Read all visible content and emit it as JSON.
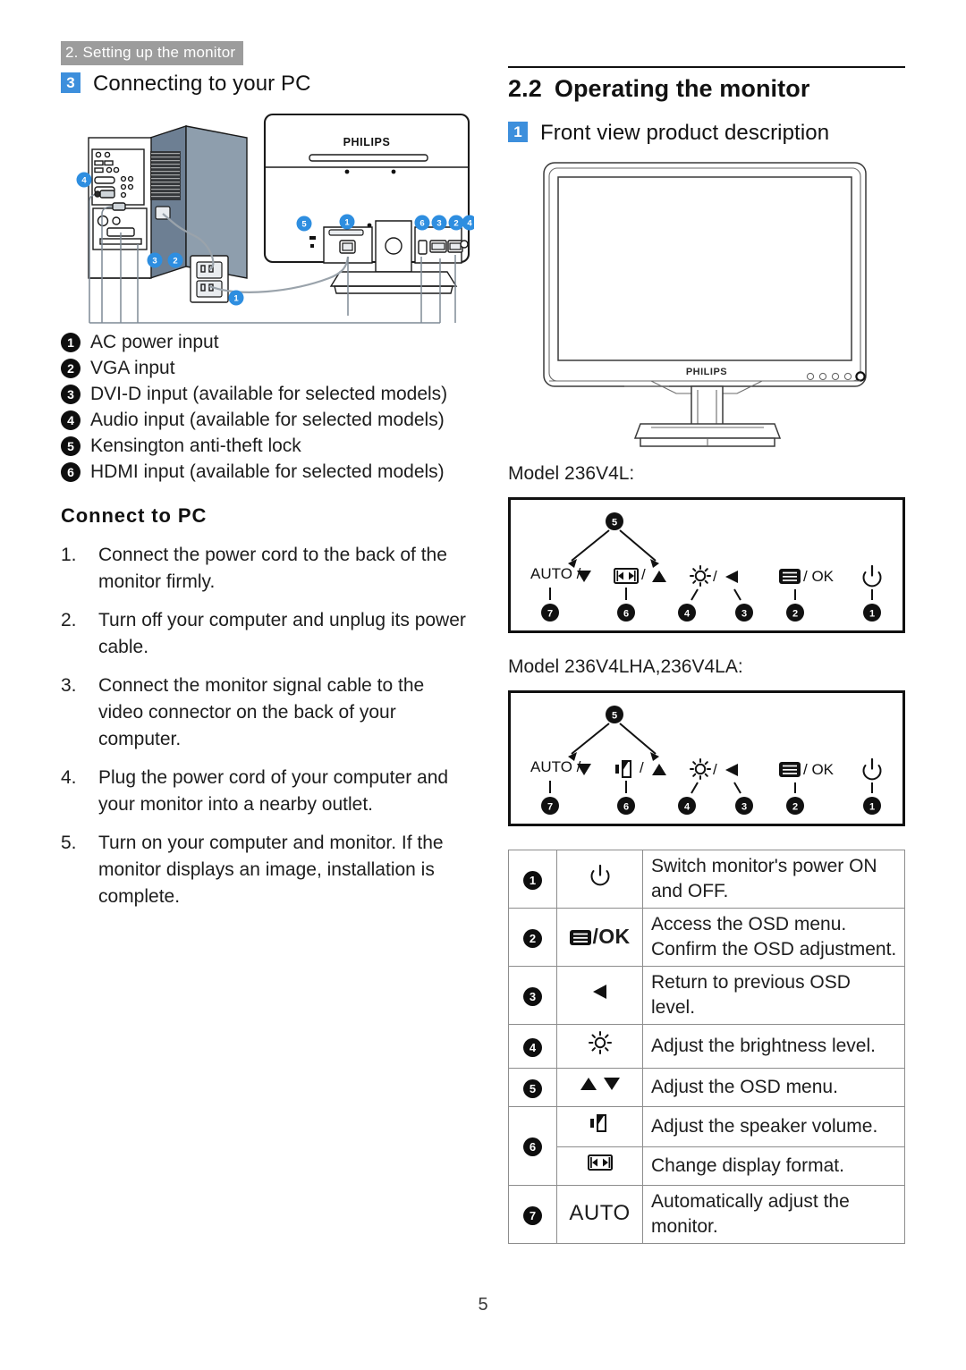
{
  "chapter": {
    "band_label": "2. Setting up the monitor"
  },
  "page": {
    "number": "5"
  },
  "left": {
    "section": {
      "badge": "3",
      "title": "Connecting to your PC"
    },
    "diagram": {
      "name": "pc-to-monitor-connection-diagram",
      "brand": "PHILIPS",
      "callouts": [
        "1",
        "2",
        "3",
        "4",
        "5",
        "6"
      ]
    },
    "ports": [
      {
        "num": "1",
        "label": "AC power input"
      },
      {
        "num": "2",
        "label": "VGA input"
      },
      {
        "num": "3",
        "label": "DVI-D input (available for selected models)"
      },
      {
        "num": "4",
        "label": "Audio input (available for selected models)"
      },
      {
        "num": "5",
        "label": "Kensington anti-theft lock"
      },
      {
        "num": "6",
        "label": "HDMI input (available for selected models)"
      }
    ],
    "connect_heading": "Connect to PC",
    "steps": [
      {
        "num": "1.",
        "text": "Connect the power cord to the back of the monitor firmly."
      },
      {
        "num": "2.",
        "text": "Turn off your computer and unplug its power cable."
      },
      {
        "num": "3.",
        "text": "Connect the monitor signal cable to the video connector on the back of your computer."
      },
      {
        "num": "4.",
        "text": "Plug the power cord of your computer and your monitor into a nearby outlet."
      },
      {
        "num": "5.",
        "text": "Turn on your computer and monitor. If the monitor displays an image,  installation is complete."
      }
    ]
  },
  "right": {
    "section_number": "2.2",
    "section_title": "Operating the monitor",
    "subsection": {
      "badge": "1",
      "title": "Front view product description"
    },
    "front_view": {
      "name": "monitor-front-view",
      "brand": "PHILIPS"
    },
    "models": [
      {
        "label": "Model 236V4L:",
        "name": "control-panel-236v4l",
        "buttons": [
          {
            "num": "7",
            "glyph": "AUTO /",
            "icon": "down-triangle-icon"
          },
          {
            "num": "6",
            "glyph": "/",
            "icon": "display-format-icon",
            "icon2": "up-triangle-icon"
          },
          {
            "num": "4",
            "icon": "brightness-icon"
          },
          {
            "num": "3",
            "icon": "left-triangle-icon"
          },
          {
            "num": "2",
            "icon": "osd-menu-icon",
            "glyph": "/ OK"
          },
          {
            "num": "1",
            "icon": "power-icon"
          }
        ],
        "top_callout": "5"
      },
      {
        "label": "Model 236V4LHA,236V4LA:",
        "name": "control-panel-236v4lha",
        "buttons": [
          {
            "num": "7",
            "glyph": "AUTO /",
            "icon": "down-triangle-icon"
          },
          {
            "num": "6",
            "glyph": "/",
            "icon": "speaker-icon",
            "icon2": "up-triangle-icon"
          },
          {
            "num": "4",
            "icon": "brightness-icon"
          },
          {
            "num": "3",
            "icon": "left-triangle-icon"
          },
          {
            "num": "2",
            "icon": "osd-menu-icon",
            "glyph": "/ OK"
          },
          {
            "num": "1",
            "icon": "power-icon"
          }
        ],
        "top_callout": "5"
      }
    ],
    "button_table": [
      {
        "num": "1",
        "icon": "power-icon",
        "icon_text": "",
        "desc": "Switch monitor's power ON and OFF."
      },
      {
        "num": "2",
        "icon": "osd-menu-icon",
        "icon_text": "/OK",
        "desc": "Access the OSD menu.\nConfirm the OSD adjustment."
      },
      {
        "num": "3",
        "icon": "left-triangle-icon",
        "icon_text": "",
        "desc": "Return to previous OSD level."
      },
      {
        "num": "4",
        "icon": "brightness-icon",
        "icon_text": "",
        "desc": "Adjust the brightness level."
      },
      {
        "num": "5",
        "icon": "up-down-triangle-icon",
        "icon_text": "",
        "desc": "Adjust the OSD menu."
      },
      {
        "num": "6",
        "icon": "speaker-icon",
        "icon_text": "",
        "desc": "Adjust the speaker volume."
      },
      {
        "num": "",
        "icon": "display-format-icon",
        "icon_text": "",
        "desc": "Change display format."
      },
      {
        "num": "7",
        "icon": "auto-text-icon",
        "icon_text": "AUTO",
        "desc": "Automatically adjust the monitor."
      }
    ]
  },
  "colors": {
    "band_gray": "#9c9c9c",
    "badge_blue": "#3d8fdc",
    "callout_blue": "#2e8ee0",
    "ink": "#111111",
    "tower_body": "#6d7f93"
  }
}
